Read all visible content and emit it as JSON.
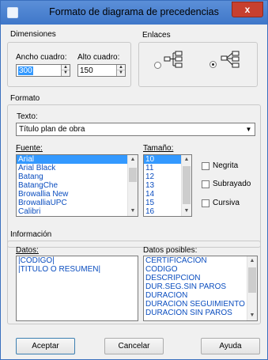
{
  "window": {
    "title": "Formato de diagrama de precedencias",
    "close_label": "x"
  },
  "dimensions": {
    "group_label": "Dimensiones",
    "width_label": "Ancho cuadro:",
    "width_value": "300",
    "height_label": "Alto cuadro:",
    "height_value": "150"
  },
  "links": {
    "group_label": "Enlaces",
    "options": [
      {
        "icon": "diagram-orthogonal-icon",
        "selected": false
      },
      {
        "icon": "diagram-straight-icon",
        "selected": true
      }
    ]
  },
  "format": {
    "group_label": "Formato",
    "text_label": "Texto:",
    "text_value": "Título plan de obra",
    "font_label": "Fuente:",
    "fonts": [
      "Arial",
      "Arial Black",
      "Batang",
      "BatangChe",
      "Browallia New",
      "BrowalliaUPC",
      "Calibri"
    ],
    "selected_font": "Arial",
    "size_label": "Tamaño:",
    "sizes": [
      "10",
      "11",
      "12",
      "13",
      "14",
      "15",
      "16"
    ],
    "selected_size": "10",
    "bold_label": "Negrita",
    "underline_label": "Subrayado",
    "italic_label": "Cursiva"
  },
  "information": {
    "group_label": "Información",
    "data_label": "Datos:",
    "data_items": [
      "|CÓDIGO|",
      "|TÍTULO O RESUMEN|"
    ],
    "possible_label": "Datos posibles:",
    "possible_items": [
      "CERTIFICACIÓN",
      "CÓDIGO",
      "DESCRIPCIÓN",
      "DUR.SEG.SIN PAROS",
      "DURACIÓN",
      "DURACIÓN SEGUIMIENTO",
      "DURACIÓN SIN PAROS"
    ]
  },
  "buttons": {
    "accept": "Aceptar",
    "cancel": "Cancelar",
    "help": "Ayuda"
  },
  "colors": {
    "titlebar": "#4a82d0",
    "close": "#c7402f",
    "selection": "#3399ff",
    "list_text": "#0a4dbf"
  }
}
